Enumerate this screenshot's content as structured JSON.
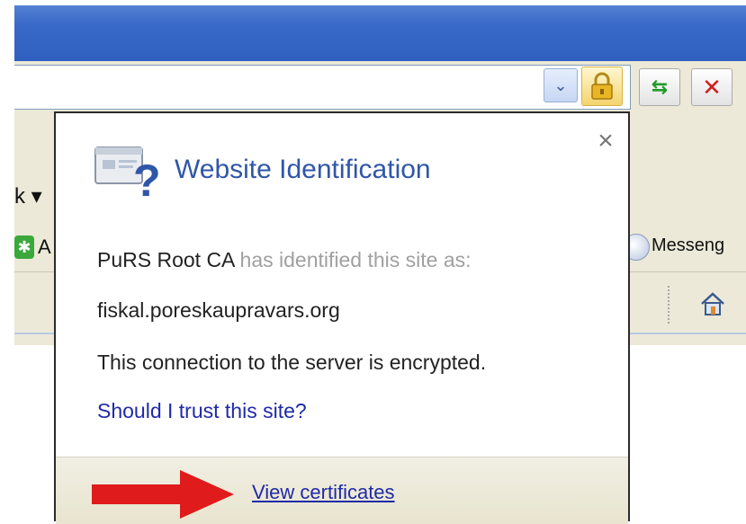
{
  "toolbar": {
    "back_partial": "k ▾",
    "a_partial": "A",
    "messenger_partial": "Messeng"
  },
  "popup": {
    "title": "Website Identification",
    "close_glyph": "×",
    "issuer": "PuRS Root CA",
    "identified_text": " has identified this site as:",
    "site": "fiskal.poreskaupravars.org",
    "encryption": "This connection to the server is encrypted.",
    "trust_link": "Should I trust this site?",
    "view_certificates": "View certificates"
  },
  "icons": {
    "dropdown": "chevron-down-icon",
    "lock": "lock-icon",
    "refresh": "refresh-icon",
    "stop": "stop-icon",
    "home": "home-icon",
    "site_identity": "website-identification-icon",
    "arrow": "red-arrow-icon"
  },
  "colors": {
    "titlebar": "#3a6ac8",
    "link": "#1f2aa8",
    "title": "#2f56a8",
    "arrow": "#e01b1b"
  }
}
